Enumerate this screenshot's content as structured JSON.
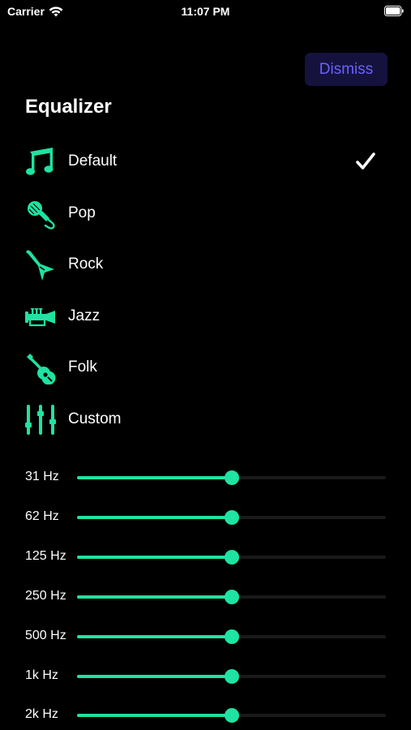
{
  "status_bar": {
    "carrier": "Carrier",
    "time": "11:07 PM"
  },
  "dismiss_label": "Dismiss",
  "title": "Equalizer",
  "accent_color": "#1ee3a2",
  "presets": [
    {
      "label": "Default",
      "icon": "music-notes-icon",
      "selected": true
    },
    {
      "label": "Pop",
      "icon": "microphone-icon",
      "selected": false
    },
    {
      "label": "Rock",
      "icon": "electric-guitar-icon",
      "selected": false
    },
    {
      "label": "Jazz",
      "icon": "trumpet-icon",
      "selected": false
    },
    {
      "label": "Folk",
      "icon": "acoustic-guitar-icon",
      "selected": false
    },
    {
      "label": "Custom",
      "icon": "sliders-icon",
      "selected": false
    }
  ],
  "bands": [
    {
      "label": "31 Hz",
      "value": 0.5
    },
    {
      "label": "62 Hz",
      "value": 0.5
    },
    {
      "label": "125 Hz",
      "value": 0.5
    },
    {
      "label": "250 Hz",
      "value": 0.5
    },
    {
      "label": "500 Hz",
      "value": 0.5
    },
    {
      "label": "1k Hz",
      "value": 0.5
    },
    {
      "label": "2k Hz",
      "value": 0.5
    }
  ]
}
